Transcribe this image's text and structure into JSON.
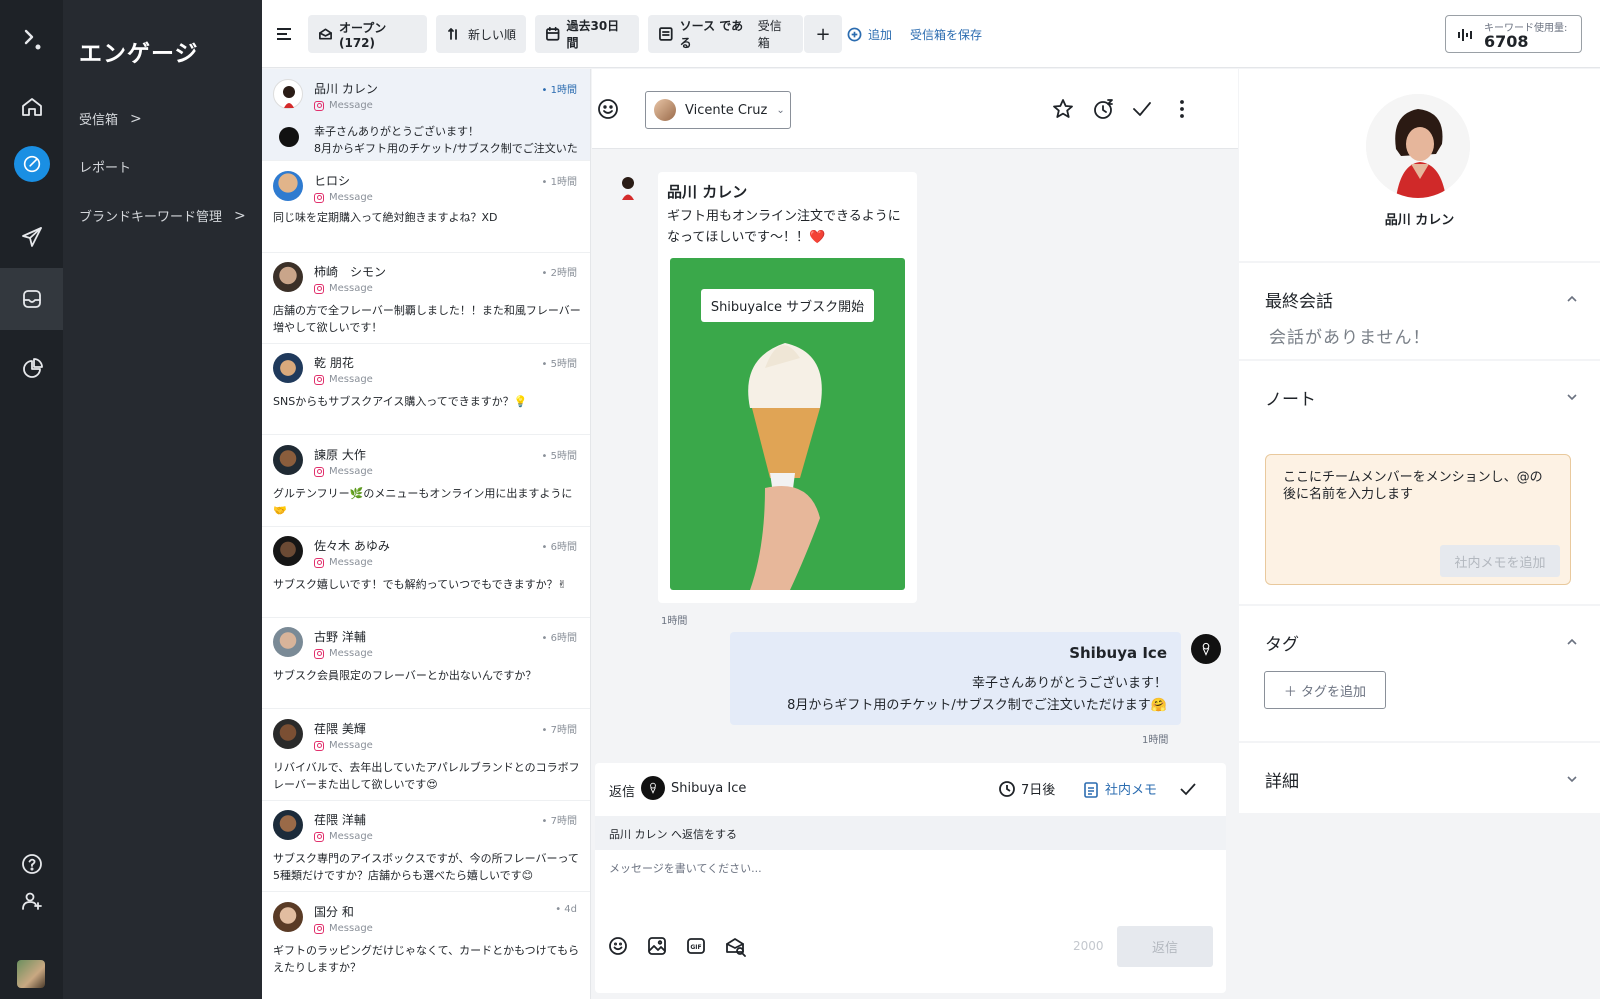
{
  "colors": {
    "accent": "#1a8fe3",
    "link": "#2b6cb0",
    "rail_bg": "#1e2227",
    "nav_bg": "#262a30"
  },
  "nav": {
    "title": "エンゲージ",
    "items": [
      {
        "label": "受信箱",
        "chevron": ">"
      },
      {
        "label": "レポート"
      },
      {
        "label": "ブランドキーワード管理",
        "chevron": ">"
      }
    ]
  },
  "rail": {
    "icons": [
      "logo-icon",
      "home-icon",
      "compose-icon",
      "publish-icon",
      "inbox-icon",
      "reports-icon",
      "help-icon",
      "add-user-icon"
    ]
  },
  "toolbar": {
    "open": "オープン(172)",
    "sort": "新しい順",
    "range": "過去30日間",
    "source_a": "ソース である",
    "source_b": "受信箱",
    "plus": "+",
    "add": "追加",
    "save_inbox": "受信箱を保存",
    "keyword_label": "キーワード使用量:",
    "keyword_value": "6708"
  },
  "conversations": [
    {
      "name": "品川 カレン",
      "source": "Message",
      "time": "• 1時間",
      "message": "幸子さんありがとうございます！\n8月からギフト用のチケット/サブスク制でご注文いた"
    },
    {
      "name": "ヒロシ",
      "source": "Message",
      "time": "• 1時間",
      "message": "同じ味を定期購入って絶対飽きますよね？XD"
    },
    {
      "name": "柿崎　シモン",
      "source": "Message",
      "time": "• 2時間",
      "message": "店舗の方で全フレーバー制覇しました！！また和風フレーバー増やして欲しいです！"
    },
    {
      "name": "乾 朋花",
      "source": "Message",
      "time": "• 5時間",
      "message": "SNSからもサブスクアイス購入ってできますか？💡"
    },
    {
      "name": "諫原 大作",
      "source": "Message",
      "time": "• 5時間",
      "message": "グルテンフリー🌿のメニューもオンライン用に出ますように🤝"
    },
    {
      "name": "佐々木 あゆみ",
      "source": "Message",
      "time": "• 6時間",
      "message": "サブスク嬉しいです！でも解約っていつでもできますか？✌"
    },
    {
      "name": "古野 洋輔",
      "source": "Message",
      "time": "• 6時間",
      "message": "サブスク会員限定のフレーバーとか出ないんですか？"
    },
    {
      "name": "荏隈 美輝",
      "source": "Message",
      "time": "• 7時間",
      "message": "リバイバルで、去年出していたアパレルブランドとのコラボフレーバーまた出して欲しいです😍"
    },
    {
      "name": "荏隈 洋輔",
      "source": "Message",
      "time": "• 7時間",
      "message": "サブスク専門のアイスボックスですが、今の所フレーバーって5種類だけですか？店舗からも選べたら嬉しいです😊"
    },
    {
      "name": "国分 和",
      "source": "Message",
      "time": "• 4d",
      "message": "ギフトのラッピングだけじゃなくて、カードとかもつけてもらえたりしますか？"
    }
  ],
  "chat": {
    "assignee": "Vicente Cruz",
    "incoming": {
      "name": "品川 カレン",
      "text": "ギフト用もオンライン注文できるようになってほしいです〜！！❤️",
      "image_caption": "ShibuyaIce サブスク開始",
      "time": "1時間"
    },
    "outgoing": {
      "name": "Shibuya Ice",
      "line1": "幸子さんありがとうございます！",
      "line2": "8月からギフト用のチケット/サブスク制でご注文いただけます🤗",
      "time": "1時間"
    },
    "composer": {
      "reply_label": "返信",
      "account": "Shibuya Ice",
      "schedule": "7日後",
      "internal_note": "社内メモ",
      "reply_to": "品川 カレン へ返信をする",
      "placeholder": "メッセージを書いてください...",
      "char_count": "2000",
      "send": "返信"
    }
  },
  "profile": {
    "name": "品川 カレン",
    "last_conversation_title": "最終会話",
    "no_conversation": "会話がありません！",
    "note_title": "ノート",
    "note_placeholder": "ここにチームメンバーをメンションし、@の後に名前を入力します",
    "note_button": "社内メモを追加",
    "tags_title": "タグ",
    "add_tag": "＋ タグを追加",
    "details_title": "詳細"
  }
}
